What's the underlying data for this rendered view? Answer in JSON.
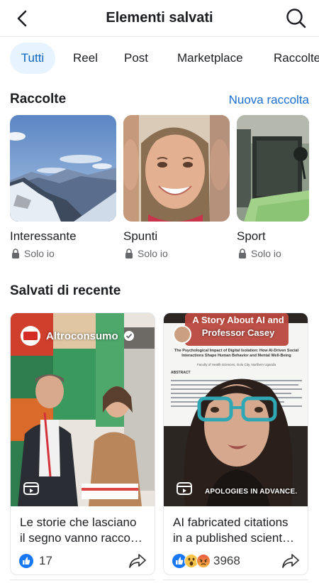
{
  "header": {
    "title": "Elementi salvati",
    "back_icon": "chevron-left-icon",
    "search_icon": "search-icon"
  },
  "tabs": [
    {
      "label": "Tutti",
      "active": true
    },
    {
      "label": "Reel",
      "active": false
    },
    {
      "label": "Post",
      "active": false
    },
    {
      "label": "Marketplace",
      "active": false
    },
    {
      "label": "Raccolte",
      "active": false
    }
  ],
  "collections_section": {
    "title": "Raccolte",
    "new_label": "Nuova raccolta",
    "items": [
      {
        "name": "Interessante",
        "privacy": "Solo io"
      },
      {
        "name": "Spunti",
        "privacy": "Solo io"
      },
      {
        "name": "Sport",
        "privacy": "Solo io"
      }
    ]
  },
  "recent_section": {
    "title": "Salvati di recente",
    "items": [
      {
        "author": "Altroconsumo",
        "verified": true,
        "caption_line1": "Le storie che lasciano",
        "caption_line2": "il segno vanno racco…",
        "reactions": [
          "like"
        ],
        "count": "17"
      },
      {
        "author": "Professor Casey",
        "overlay_title_1": "A Story About AI and",
        "paper_title": "The Psychological Impact of Digital Isolation: How AI-Driven Social Interactions Shape Human Behavior and Mental Well-Being",
        "paper_meta": "Faculty of Health Sciences, Gulu City, Northern Uganda",
        "paper_section": "ABSTRACT",
        "subtitle": "APOLOGIES IN ADVANCE.",
        "caption_line1": "AI fabricated citations",
        "caption_line2": "in a published scient…",
        "reactions": [
          "like",
          "wow",
          "angry"
        ],
        "count": "3968"
      }
    ]
  },
  "colors": {
    "accent": "#1a6fd1",
    "active_tab_bg": "#e7f3ff",
    "like_blue": "#1877f2"
  }
}
